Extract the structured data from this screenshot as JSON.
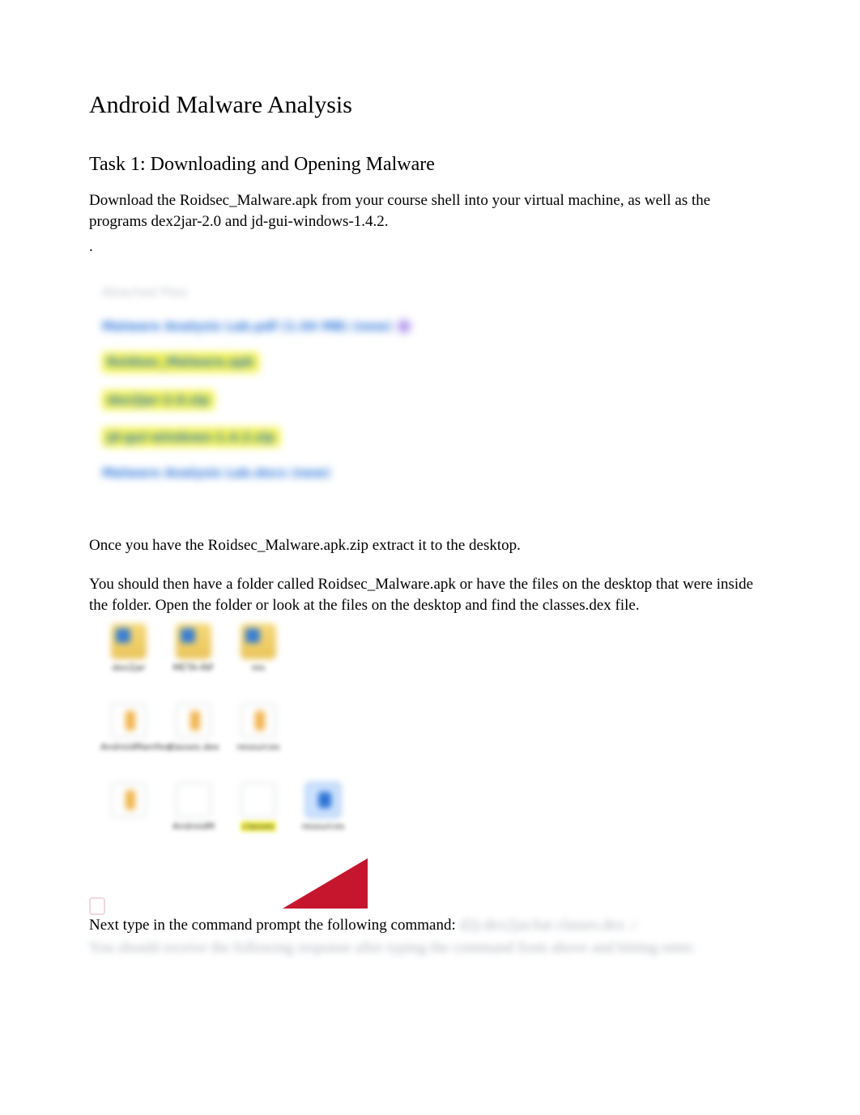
{
  "title": "Android Malware Analysis",
  "task_heading": "Task 1: Downloading and Opening Malware",
  "intro": "Download the Roidsec_Malware.apk from your course shell into your virtual machine, as well as the programs dex2jar-2.0 and jd-gui-windows-1.4.2.",
  "dot": ".",
  "link_list": {
    "header": "Attached Files",
    "items": [
      {
        "text": "Malware Analysis Lab.pdf (1.04 MB) (new)",
        "highlight": false,
        "tail": "",
        "icon": true
      },
      {
        "text": "Roidsec_Malware.apk",
        "highlight": true,
        "tail": "",
        "icon": false
      },
      {
        "text": "dex2jar-2.0.zip",
        "highlight": true,
        "tail": "",
        "icon": false
      },
      {
        "text": "jd-gui-windows-1.4.2.zip",
        "highlight": true,
        "tail": "",
        "icon": false
      },
      {
        "text": "Malware Analysis Lab.docx (new)",
        "highlight": false,
        "tail": "",
        "icon": true
      }
    ]
  },
  "para_extract": "Once you have the Roidsec_Malware.apk.zip extract it to the desktop.",
  "para_folder": "You should then have a folder called Roidsec_Malware.apk or have the files on the desktop that were inside the folder. Open the folder or look at the files on the desktop and find the classes.dex file.",
  "icon_grid": {
    "row1": [
      {
        "type": "folder",
        "label": "dex2jar"
      },
      {
        "type": "folder",
        "label": "META-INF"
      },
      {
        "type": "folder",
        "label": "res"
      }
    ],
    "row2": [
      {
        "type": "file",
        "label": "AndroidManifest"
      },
      {
        "type": "file",
        "label": "classes.dex"
      },
      {
        "type": "file",
        "label": "resources"
      }
    ],
    "row3": [
      {
        "type": "file",
        "label": ""
      },
      {
        "type": "plain",
        "label": "AndroidM"
      },
      {
        "type": "plain",
        "label": "classes",
        "highlight": true
      },
      {
        "type": "blue",
        "label": "resources"
      }
    ]
  },
  "cmd_line": {
    "prefix": "Next type in the command prompt the following command: ",
    "obscured_inline": "d2j-dex2jar.bat classes.dex ./",
    "obscured_block": "You should receive the following response after typing the command from above and hitting enter."
  }
}
